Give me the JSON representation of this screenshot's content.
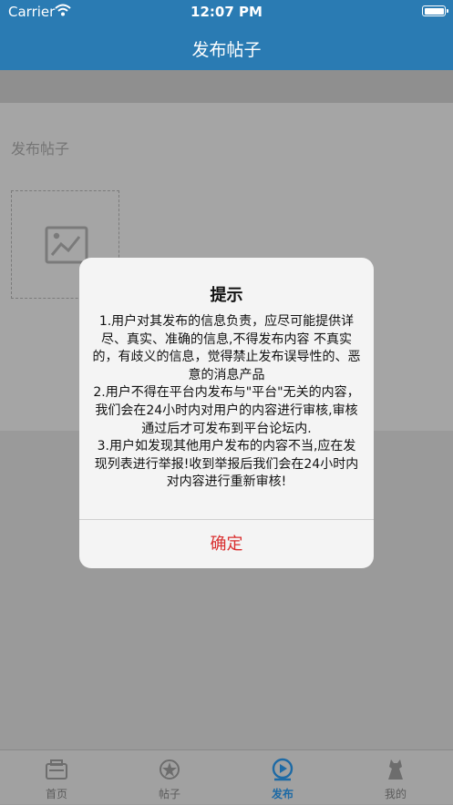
{
  "status_bar": {
    "carrier": "Carrier",
    "time": "12:07 PM"
  },
  "nav": {
    "title": "发布帖子"
  },
  "form": {
    "label": "发布帖子"
  },
  "alert": {
    "title": "提示",
    "message": "1.用户对其发布的信息负责，应尽可能提供详尽、真实、准确的信息,不得发布内容 不真实的，有歧义的信息，觉得禁止发布误导性的、恶意的消息产品\n2.用户不得在平台内发布与\"平台\"无关的内容，我们会在24小时内对用户的内容进行审核,审核通过后才可发布到平台论坛内.\n3.用户如发现其他用户发布的内容不当,应在发现列表进行举报!收到举报后我们会在24小时内对内容进行重新审核!",
    "confirm_label": "确定",
    "confirm_color": "#d92e2e"
  },
  "tabs": [
    {
      "label": "首页",
      "icon": "home-icon",
      "active": false
    },
    {
      "label": "帖子",
      "icon": "posts-icon",
      "active": false
    },
    {
      "label": "发布",
      "icon": "publish-icon",
      "active": true
    },
    {
      "label": "我的",
      "icon": "profile-icon",
      "active": false
    }
  ],
  "colors": {
    "nav_bar": "#2a7bb3",
    "tab_active": "#1d6aa5"
  }
}
